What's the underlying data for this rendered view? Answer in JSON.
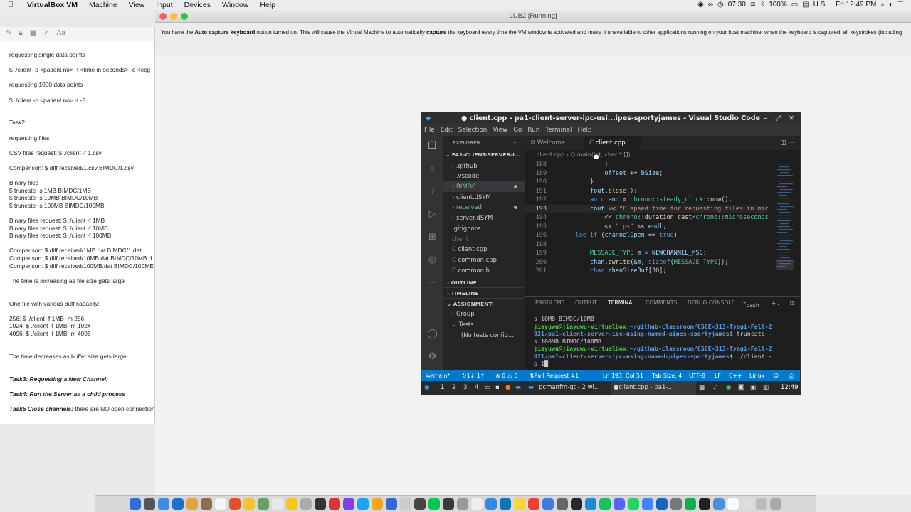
{
  "menubar": {
    "app_name": "VirtualBox VM",
    "items": [
      "Machine",
      "View",
      "Input",
      "Devices",
      "Window",
      "Help"
    ],
    "status_time_small": "07:30",
    "battery": "100%",
    "input_lang": "U.S.",
    "clock": "Fri 12:49 PM"
  },
  "notes": {
    "lines": [
      {
        "text": "requesting single data points",
        "style": "n"
      },
      {
        "text": "",
        "style": "n"
      },
      {
        "text": "$ ./client -p <patient no> -t <time in seconds> -e <ecg",
        "style": "n"
      },
      {
        "text": "",
        "style": "n"
      },
      {
        "text": "requesting 1000 data points",
        "style": "n"
      },
      {
        "text": "",
        "style": "n"
      },
      {
        "text": "$ ./client -p <patient no> -t -5",
        "style": "n"
      },
      {
        "text": "",
        "style": "n"
      },
      {
        "text": "",
        "style": "n"
      },
      {
        "text": "Task2:",
        "style": "n"
      },
      {
        "text": "",
        "style": "n"
      },
      {
        "text": "requesting files",
        "style": "n"
      },
      {
        "text": "",
        "style": "n"
      },
      {
        "text": "CSV files request: $ ./client -f 1.csv",
        "style": "n"
      },
      {
        "text": "",
        "style": "n"
      },
      {
        "text": "Comparison:   $ diff received/1.csv BIMDC/1.csv",
        "style": "n"
      },
      {
        "text": "",
        "style": "n"
      },
      {
        "text": "Binary files",
        "style": "n"
      },
      {
        "text": "$ truncate -s 1MB BIMDC/1MB",
        "style": "n"
      },
      {
        "text": "$ truncate -s 10MB BIMDC/10MB",
        "style": "n"
      },
      {
        "text": "$ truncate -s 100MB BIMDC/100MB",
        "style": "n"
      },
      {
        "text": "",
        "style": "n"
      },
      {
        "text": "Binary files request: $ ./client -f 1MB",
        "style": "n"
      },
      {
        "text": "Binary files request: $ ./client -f 10MB",
        "style": "n"
      },
      {
        "text": "Binary files request: $ ./client -f 100MB",
        "style": "n"
      },
      {
        "text": "",
        "style": "n"
      },
      {
        "text": "Comparison:   $ diff received/1MB.dat BIMDC/1.dat",
        "style": "n"
      },
      {
        "text": "Comparison:   $ diff received/10MB.dat BIMDC/10MB.d",
        "style": "n"
      },
      {
        "text": "Comparison:  $ diff received/100MB.dat BIMDC/100ME",
        "style": "n"
      },
      {
        "text": "",
        "style": "n"
      },
      {
        "text": "The time is increasing as file size gets large",
        "style": "n"
      },
      {
        "text": "",
        "style": "n"
      },
      {
        "text": "",
        "style": "n"
      },
      {
        "text": "One file with various buff capacity:",
        "style": "n"
      },
      {
        "text": "",
        "style": "n"
      },
      {
        "text": "256: $ ./client -f 1MB -m 256",
        "style": "n"
      },
      {
        "text": "1024: $ ./client -f 1MB -m 1024",
        "style": "n"
      },
      {
        "text": "4096: $ ./client -f 1MB -m 4096",
        "style": "n"
      },
      {
        "text": "",
        "style": "n"
      },
      {
        "text": "",
        "style": "n"
      },
      {
        "text": "The time decreases as buffer size gets large",
        "style": "n"
      },
      {
        "text": "",
        "style": "n"
      },
      {
        "text": "",
        "style": "n"
      },
      {
        "text": "Task3: Requesting a New Channel:",
        "style": "b"
      },
      {
        "text": "",
        "style": "n"
      },
      {
        "text": "Task4: Run the Server as a child process",
        "style": "b"
      },
      {
        "text": "",
        "style": "n"
      },
      {
        "text": "Task5 Close channels:",
        "style": "b",
        "rest": " there are NO open connection"
      }
    ]
  },
  "vbox": {
    "title": "LUB2 [Running]",
    "info_prefix": "You have the ",
    "info_bold1": "Auto capture keyboard",
    "info_mid": " option turned on. This will cause the Virtual Machine to automatically ",
    "info_bold2": "capture",
    "info_rest": " the keyboard every time the VM window is activated and make it unavailable to other applications running on your host machine: when the keyboard is captured, all keystrokes (including"
  },
  "vscode": {
    "title": "● client.cpp - pa1-client-server-ipc-usi...ipes-sportyjames - Visual Studio Code",
    "menu": [
      "File",
      "Edit",
      "Selection",
      "View",
      "Go",
      "Run",
      "Terminal",
      "Help"
    ],
    "explorer_label": "EXPLORER",
    "project_label": "PA1-CLIENT-SERVER-I...",
    "files": [
      {
        "name": ".github",
        "type": "folder",
        "color": "#cccccc"
      },
      {
        "name": ".vscode",
        "type": "folder",
        "color": "#cccccc"
      },
      {
        "name": "BIMDC",
        "type": "folder",
        "color": "#73c991",
        "dot": true,
        "selected": true
      },
      {
        "name": "client.dSYM",
        "type": "folder",
        "color": "#cccccc"
      },
      {
        "name": "received",
        "type": "folder",
        "color": "#73c991",
        "dot": true
      },
      {
        "name": "server.dSYM",
        "type": "folder",
        "color": "#cccccc"
      },
      {
        "name": ".gitignore",
        "type": "file",
        "color": "#cccccc"
      },
      {
        "name": "client",
        "type": "file",
        "color": "#777777"
      },
      {
        "name": "client.cpp",
        "type": "file",
        "color": "#cccccc"
      },
      {
        "name": "common.cpp",
        "type": "file",
        "color": "#cccccc"
      },
      {
        "name": "common.h",
        "type": "file",
        "color": "#cccccc"
      }
    ],
    "outline_label": "OUTLINE",
    "timeline_label": "TIMELINE",
    "assignment_label": "ASSIGNMENT:",
    "group_label": "Group",
    "tests_label": "Tests",
    "no_tests_label": "(No tests config...",
    "tab_welcome": "Welcome",
    "tab_active": "client.cpp",
    "breadcrumb_file": "client.cpp",
    "breadcrumb_fn": "main(int, char * [])",
    "code_lines": [
      {
        "no": "188",
        "html": "            <span class='pl'>}</span>"
      },
      {
        "no": "189",
        "html": "            <span class='vr'>offset</span> <span class='pl'>+=</span> <span class='vr'>bSize</span><span class='pl'>;</span>"
      },
      {
        "no": "190",
        "html": "        <span class='pl'>}</span>"
      },
      {
        "no": "191",
        "html": "        <span class='vr'>fout</span><span class='pl'>.</span><span class='fn'>close</span><span class='pl'>();</span>"
      },
      {
        "no": "192",
        "html": "        <span class='kw'>auto</span> <span class='vr'>end</span> <span class='pl'>=</span> <span class='ty'>chrono</span><span class='pl'>::</span><span class='ty'>steady_clock</span><span class='pl'>::</span><span class='fn'>now</span><span class='pl'>();</span>"
      },
      {
        "no": "193",
        "html": "        <span class='vr'>cout</span> <span class='pl'>&lt;&lt;</span> <span class='st'>\"Elapsed time for requesting files in mic</span>"
      },
      {
        "no": "194",
        "html": "            <span class='pl'>&lt;&lt;</span> <span class='ty'>chrono</span><span class='pl'>::</span><span class='fn'>duration_cast</span><span class='pl'>&lt;</span><span class='ty'>chrono</span><span class='pl'>::</span><span class='ty'>microseconds</span>"
      },
      {
        "no": "195",
        "html": "            <span class='pl'>&lt;&lt;</span> <span class='st'>\" µs\"</span> <span class='pl'>&lt;&lt;</span> <span class='vr'>endl</span><span class='pl'>;</span>"
      },
      {
        "no": "196",
        "html": "    <span class='kw'>lse if</span> <span class='pl'>(</span><span class='vr'>channelOpen</span> <span class='pl'>==</span> <span class='kw'>true</span><span class='pl'>)</span>"
      },
      {
        "no": "198",
        "html": ""
      },
      {
        "no": "199",
        "html": "        <span class='ty'>MESSAGE_TYPE</span> <span class='vr'>m</span> <span class='pl'>=</span> <span class='vr'>NEWCHANNEL_MSG</span><span class='pl'>;</span>"
      },
      {
        "no": "200",
        "html": "        <span class='vr'>chan</span><span class='pl'>.</span><span class='fn'>cwrite</span><span class='pl'>(&amp;</span><span class='vr'>m</span><span class='pl'>,</span> <span class='kw'>sizeof</span><span class='pl'>(</span><span class='ty'>MESSAGE_TYPE</span><span class='pl'>));</span>"
      },
      {
        "no": "201",
        "html": "        <span class='kw'>char</span> <span class='vr'>chanSizeBuf</span><span class='pl'>[30];</span>"
      }
    ],
    "panel_tabs": [
      "PROBLEMS",
      "OUTPUT",
      "TERMINAL",
      "COMMENTS",
      "DEBUG CONSOLE"
    ],
    "shell_label": "bash",
    "terminal_lines": [
      {
        "plain": "s 10MB BIMDC/10MB"
      },
      {
        "user": "jiayuwu@jiayuwu-virtualbox",
        "path": ":~/github-classroom/CSCE-313-Tyagi-Fall-2"
      },
      {
        "path": "021/pa1-client-server-ipc-using-named-pipes-sportyjames",
        "plain": "$ truncate -"
      },
      {
        "plain": "s 100MB BIMDC/100MB"
      },
      {
        "user": "jiayuwu@jiayuwu-virtualbox",
        "path": ":~/github-classroom/CSCE-313-Tyagi-Fall-2"
      },
      {
        "path": "021/pa1-client-server-ipc-using-named-pipes-sportyjames",
        "plain": "$ ./client -"
      },
      {
        "plain": "p 1"
      }
    ],
    "status": {
      "branch": "main*",
      "sync": "1↓ 1↑",
      "problems": "⊗ 0 ⚠ 0",
      "pull_request": "Pull Request #1",
      "position": "Ln 193, Col 51",
      "tab_size": "Tab Size: 4",
      "encoding": "UTF-8",
      "eol": "LF",
      "language": "C++",
      "os": "Linux"
    },
    "lxpanel": {
      "workspaces": [
        "1",
        "2",
        "3",
        "4"
      ],
      "task1": "pcmanfm-qt - 2 wi...",
      "task2": "client.cpp - pa1-...",
      "time": "12:49"
    }
  },
  "dock_colors": [
    "#2f6fd6",
    "#555",
    "#3c8de8",
    "#1a6fd1",
    "#e6a23c",
    "#8d6e4d",
    "#f5f5f5",
    "#e34f26",
    "#f4c430",
    "#68a063",
    "#e8e8e8",
    "#f5c518",
    "#aaa",
    "#333",
    "#d33",
    "#7b3fe4",
    "#1da1f2",
    "#f5a623",
    "#3367d6",
    "#ccc",
    "#444",
    "#00c853",
    "#3a3a3a",
    "#999",
    "#eee",
    "#2f8be3",
    "#0d75bc",
    "#ffd43b",
    "#ea4335",
    "#3b7ddd",
    "#666",
    "#24292e",
    "#1c8adb",
    "#17bf63",
    "#5865f2",
    "#25d366",
    "#3f83f8",
    "#1565c0",
    "#777",
    "#0db04b",
    "#222",
    "#4a90d9",
    "#fafafa",
    "#ddd",
    "#bbb",
    "#aaa"
  ]
}
